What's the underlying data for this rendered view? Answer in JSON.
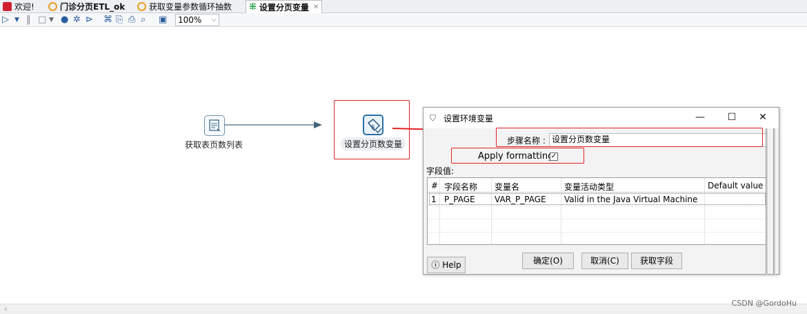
{
  "tabs": [
    {
      "label": "欢迎!",
      "icon": "welcome-icon",
      "color": "#d02030"
    },
    {
      "label": "门诊分页ETL_ok",
      "icon": "transformation-icon",
      "color": "#e8a020"
    },
    {
      "label": "获取变量参数循环抽数",
      "icon": "transformation-icon",
      "color": "#e8a020"
    },
    {
      "label": "设置分页变量",
      "icon": "job-icon",
      "color": "#2a9d4a",
      "active": true
    }
  ],
  "toolbar": {
    "zoom": "100%"
  },
  "canvas": {
    "step1_label": "获取表页数列表",
    "step2_label": "设置分页数变量"
  },
  "dialog": {
    "title": "设置环境变量",
    "step_name_label": "步骤名称 :",
    "step_name_value": "设置分页数变量",
    "apply_formatting_label": "Apply formatting",
    "apply_formatting_checked": true,
    "fields_label": "字段值:",
    "columns": [
      "#",
      "字段名称",
      "变量名",
      "变量活动类型",
      "Default value"
    ],
    "rows": [
      [
        "1",
        "P_PAGE",
        "VAR_P_PAGE",
        "Valid in the Java Virtual Machine",
        ""
      ]
    ],
    "help_label": "Help",
    "ok_label": "确定(O)",
    "cancel_label": "取消(C)",
    "get_fields_label": "获取字段"
  },
  "watermark": "CSDN @GordoHu",
  "accent_red": "#e02020",
  "hop_color": "#44647c"
}
